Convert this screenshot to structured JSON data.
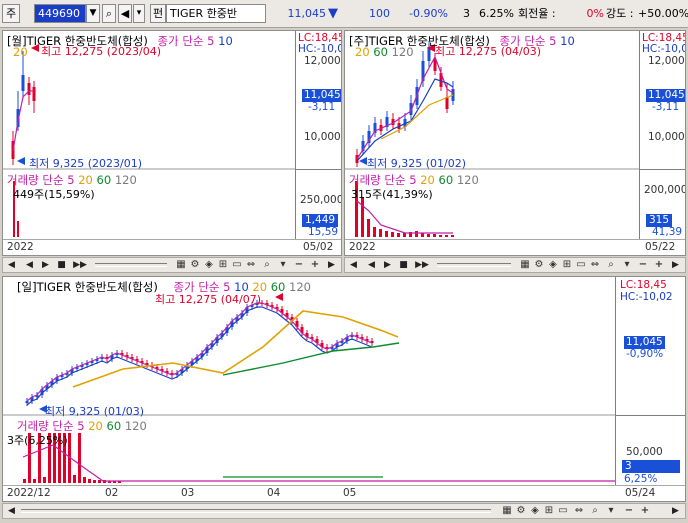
{
  "toolbar": {
    "market_label": "주",
    "code_value": "449690",
    "pen_label": "펀",
    "name_value": "TIGER 한중반",
    "price": "11,045",
    "price_arrow": "▼",
    "change": "100",
    "change_pct": "-0.90%",
    "volume_small": "3",
    "vol_pct": "6.25%",
    "turnover_label": "회전율 :",
    "turnover_value": "0%",
    "strength_label": "강도 :",
    "strength_value": "+50.00%"
  },
  "monthly": {
    "title_prefix": "[월]",
    "title": "TIGER 한중반도체(합성)",
    "ma_label": "종가 단순",
    "ma_periods": [
      "5",
      "10",
      "20"
    ],
    "high_annot": "최고 12,275 (2023/04)",
    "low_annot": "최저 9,325 (2023/01)",
    "lc": "LC:18,45",
    "hc": "HC:-10,0",
    "ticks": [
      "12,000",
      "10,000"
    ],
    "price_box": "11,045",
    "change_txt": "-3,11",
    "vol_title": "거래량",
    "vol_ma_label": "단순",
    "vol_periods": [
      "5",
      "20",
      "60",
      "120"
    ],
    "vol_annot": "449주(15,59%)",
    "vol_tick": "250,000",
    "vol_box": "1,449",
    "vol_pct": "15,59",
    "date_start": "2022",
    "date_end": "05/02"
  },
  "weekly": {
    "title_prefix": "[주]",
    "title": "TIGER 한중반도체(합성)",
    "ma_label": "종가 단순",
    "ma_periods": [
      "5",
      "10",
      "20",
      "60",
      "120"
    ],
    "high_annot": "최고 12,275 (04/03)",
    "low_annot": "최저 9,325 (01/02)",
    "lc": "LC:18,45",
    "hc": "HC:-10,0",
    "ticks": [
      "12,000",
      "10,000"
    ],
    "price_box": "11,045",
    "change_txt": "-3,11",
    "vol_title": "거래량",
    "vol_ma_label": "단순",
    "vol_periods": [
      "5",
      "20",
      "60",
      "120"
    ],
    "vol_annot": "315주(41,39%)",
    "vol_tick": "200,000",
    "vol_box": "315",
    "vol_pct": "41,39",
    "date_start": "2022",
    "date_end": "05/22"
  },
  "daily": {
    "title_prefix": "[일]",
    "title": "TIGER 한중반도체(합성)",
    "ma_label": "종가 단순",
    "ma_periods": [
      "5",
      "10",
      "20",
      "60",
      "120"
    ],
    "high_annot": "최고 12,275 (04/07)",
    "low_annot": "최저 9,325 (01/03)",
    "lc": "LC:18,45",
    "hc": "HC:-10,02",
    "price_box": "11,045",
    "change_txt": "-0,90%",
    "vol_title": "거래량",
    "vol_ma_label": "단순",
    "vol_periods": [
      "5",
      "20",
      "60",
      "120"
    ],
    "vol_annot": "3주(6,25%)",
    "vol_tick": "50,000",
    "vol_box": "3",
    "vol_pct": "6,25%",
    "dates": [
      "2022/12",
      "02",
      "03",
      "04",
      "05"
    ],
    "date_end": "05/24"
  },
  "icons": {
    "scroll_left": "◀",
    "scroll_right": "▶",
    "play_back": "◀",
    "play_fwd": "▶",
    "stop": "■",
    "fast_fwd": "▶▶",
    "zoom_minus": "−",
    "zoom_plus": "+",
    "search": "🔍"
  },
  "colors": {
    "up": "#e1002a",
    "down": "#1a50d8",
    "ma5": "#c21fa8",
    "ma10": "#1a3dc8",
    "ma20": "#e1a200",
    "ma60": "#0e8a2e",
    "ma120": "#7a7a7a"
  }
}
